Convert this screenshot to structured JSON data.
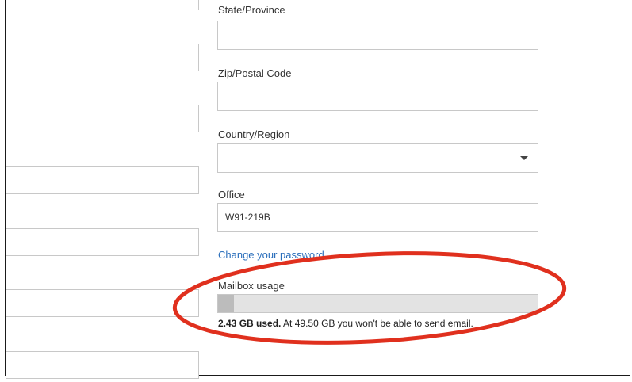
{
  "form": {
    "state_label": "State/Province",
    "zip_label": "Zip/Postal Code",
    "country_label": "Country/Region",
    "country_value": "",
    "office_label": "Office",
    "office_value": "W91-219B",
    "change_password_link": "Change your password"
  },
  "mailbox": {
    "label": "Mailbox usage",
    "used_text": "2.43 GB used.",
    "limit_text": "At 49.50 GB you won't be able to send email.",
    "used_gb": 2.43,
    "limit_gb": 49.5
  },
  "annotation": {
    "circle_color": "#e0301e"
  }
}
